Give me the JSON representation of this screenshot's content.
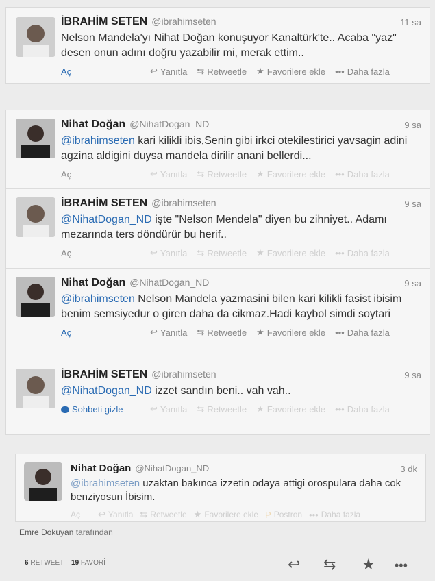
{
  "tweets": [
    {
      "name": "İBRAHİM SETEN",
      "handle": "@ibrahimseten",
      "time": "11 sa",
      "mention": "",
      "text": "Nelson Mandela'yı Nihat Doğan konuşuyor Kanaltürk'te.. Acaba \"yaz\" desen onun adını doğru yazabilir mi, merak ettim..",
      "expand": "Aç"
    },
    {
      "name": "Nihat Doğan",
      "handle": "@NihatDogan_ND",
      "time": "9 sa",
      "mention": "@ibrahimseten",
      "text": " kari kilikli ibis,Senin gibi irkci otekilestirici yavsagin adini agzina aldigini duysa mandela dirilir anani bellerdi...",
      "expand": "Aç"
    },
    {
      "name": "İBRAHİM SETEN",
      "handle": "@ibrahimseten",
      "time": "9 sa",
      "mention": "@NihatDogan_ND",
      "text": " işte \"Nelson Mendela\" diyen bu zihniyet.. Adamı mezarında ters döndürür bu herif..",
      "expand": "Aç"
    },
    {
      "name": "Nihat Doğan",
      "handle": "@NihatDogan_ND",
      "time": "9 sa",
      "mention": "@ibrahimseten",
      "text": " Nelson Mandela yazmasini bilen kari kilikli fasist ibisim benim semsiyedur o giren daha da cikmaz.Hadi kaybol simdi soytari",
      "expand": "Aç"
    },
    {
      "name": "İBRAHİM SETEN",
      "handle": "@ibrahimseten",
      "time": "9 sa",
      "mention": "@NihatDogan_ND",
      "text": " izzet sandın beni.. vah vah..",
      "expand": "Sohbeti gizle"
    }
  ],
  "final_tweet": {
    "name": "Nihat Doğan",
    "handle": "@NihatDogan_ND",
    "time": "3 dk",
    "mention": "@ibrahimseten",
    "text": " uzaktan bakınca izzetin odaya attigi orospulara daha cok benziyosun İbisim.",
    "expand": "Aç",
    "extra_action": "Postron"
  },
  "actions": {
    "reply": "Yanıtla",
    "retweet": "Retweetle",
    "favorite": "Favorilere ekle",
    "more": "Daha fazla"
  },
  "retweeted_by": {
    "user": "Emre Dokuyan",
    "suffix": "tarafından"
  },
  "stats": {
    "retweets": "6",
    "retweets_label": "RETWEET",
    "favorites": "19",
    "favorites_label": "FAVORİ"
  }
}
